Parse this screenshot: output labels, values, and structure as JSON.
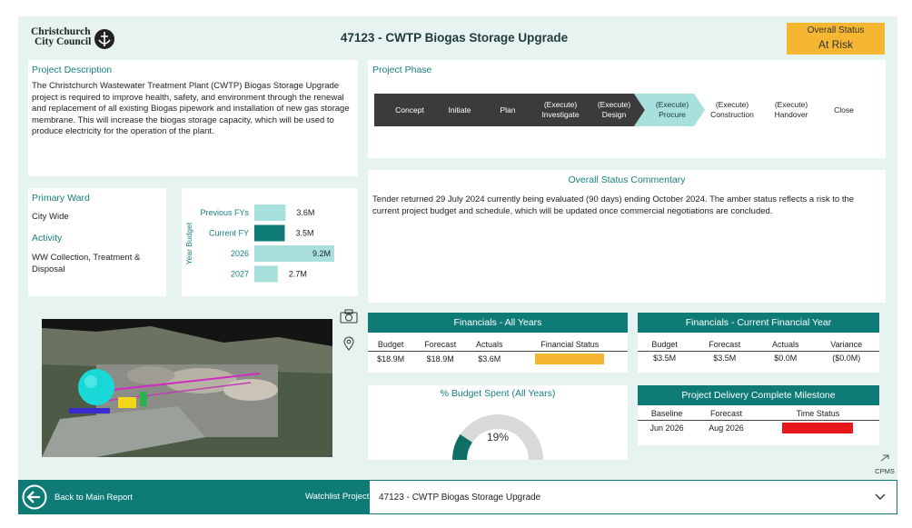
{
  "header": {
    "logo_line1": "Christchurch",
    "logo_line2": "City Council",
    "title": "47123 - CWTP Biogas Storage Upgrade",
    "status_label": "Overall Status",
    "status_value": "At Risk",
    "status_color": "#f5b731"
  },
  "description": {
    "heading": "Project Description",
    "text": "The Christchurch Wastewater Treatment Plant (CWTP) Biogas Storage Upgrade project is required to improve health, safety, and environment through the renewal and replacement of all existing Biogas pipework and installation of new gas storage membrane. This will increase the biogas storage capacity, which will be used to produce electricity for the operation of the plant."
  },
  "phase": {
    "heading": "Project Phase",
    "steps": [
      {
        "label": "Concept",
        "state": "done"
      },
      {
        "label": "Initiate",
        "state": "done"
      },
      {
        "label": "Plan",
        "state": "done"
      },
      {
        "label": "(Execute) Investigate",
        "state": "done"
      },
      {
        "label": "(Execute) Design",
        "state": "done"
      },
      {
        "label": "(Execute) Procure",
        "state": "current"
      },
      {
        "label": "(Execute) Construction",
        "state": "future"
      },
      {
        "label": "(Execute) Handover",
        "state": "future"
      },
      {
        "label": "Close",
        "state": "future"
      }
    ]
  },
  "ward": {
    "primary_label": "Primary Ward",
    "primary_value": "City Wide",
    "activity_label": "Activity",
    "activity_value": "WW Collection, Treatment & Disposal"
  },
  "chart_data": {
    "type": "bar",
    "orientation": "horizontal",
    "ylabel": "Year Budget",
    "categories": [
      "Previous FYs",
      "Current FY",
      "2026",
      "2027"
    ],
    "values": [
      3.6,
      3.5,
      9.2,
      2.7
    ],
    "labels": [
      "3.6M",
      "3.5M",
      "9.2M",
      "2.7M"
    ],
    "colors": [
      "#a8e0dd",
      "#0f7b76",
      "#a8e0dd",
      "#a8e0dd"
    ]
  },
  "commentary": {
    "heading": "Overall Status Commentary",
    "text": "Tender returned 29 July 2024 currently being evaluated (90 days) ending October 2024. The amber status reflects a risk to the current project budget and schedule, which will be updated once commercial negotiations are concluded."
  },
  "fin_all": {
    "title": "Financials - All Years",
    "headers": [
      "Budget",
      "Forecast",
      "Actuals",
      "Financial Status"
    ],
    "values": [
      "$18.9M",
      "$18.9M",
      "$3.6M"
    ],
    "status_color": "#f5b731"
  },
  "fin_current": {
    "title": "Financials - Current Financial Year",
    "headers": [
      "Budget",
      "Forecast",
      "Actuals",
      "Variance"
    ],
    "values": [
      "$3.5M",
      "$3.5M",
      "$0.0M",
      "($0.0M)"
    ]
  },
  "budget_spent": {
    "title": "% Budget Spent (All Years)",
    "percent_label": "19%",
    "fraction": 0.19
  },
  "milestone": {
    "title": "Project Delivery Complete Milestone",
    "headers": [
      "Baseline",
      "Forecast",
      "Time Status"
    ],
    "values": [
      "Jun 2026",
      "Aug 2026"
    ],
    "status_color": "#e8191b"
  },
  "cpms_label": "CPMS",
  "footer": {
    "back_label": "Back to Main Report",
    "watchlist_label": "Watchlist Project:",
    "watchlist_value": "47123 - CWTP Biogas Storage Upgrade"
  }
}
